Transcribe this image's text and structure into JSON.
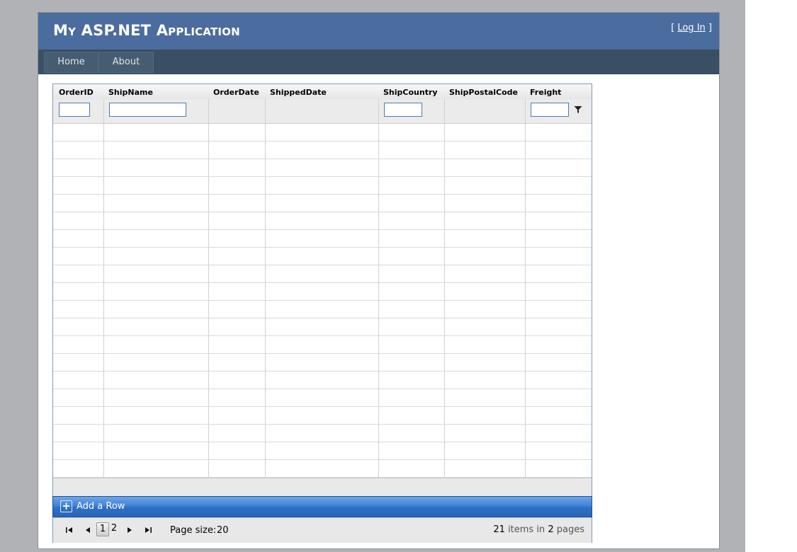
{
  "app": {
    "title": "My ASP.NET Application",
    "login_open": "[ ",
    "login_link": "Log In",
    "login_close": " ]"
  },
  "menu": [
    {
      "label": "Home"
    },
    {
      "label": "About"
    }
  ],
  "grid": {
    "columns": [
      "OrderID",
      "ShipName",
      "OrderDate",
      "ShippedDate",
      "ShipCountry",
      "ShipPostalCode",
      "Freight"
    ],
    "filters": {
      "order_id": "",
      "ship_name": "",
      "ship_country": "",
      "freight": ""
    },
    "add_row_label": "Add a Row",
    "pager": {
      "pages": [
        "1",
        "2"
      ],
      "current_page": "1",
      "page_size_label": "Page size:",
      "page_size_value": "20",
      "total_items": "21",
      "items_label": "items in",
      "total_pages": "2",
      "pages_label": "pages"
    }
  },
  "colors": {
    "header_bg": "#4b6c9e",
    "menubar_bg": "#3a4f63",
    "add_row_blue": "#3f82d6"
  }
}
